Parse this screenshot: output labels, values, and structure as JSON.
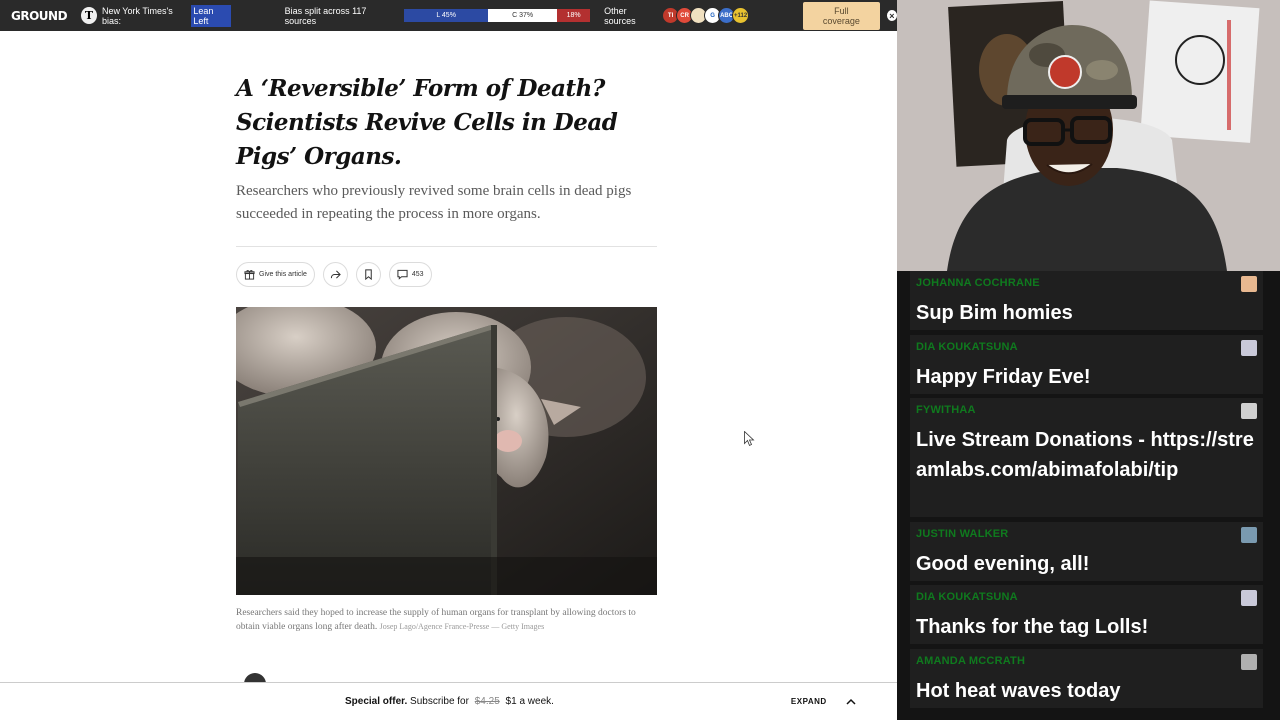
{
  "ground_bar": {
    "logo": "GROUND",
    "publisher_icon": "T",
    "bias_label": "New York Times's bias:",
    "bias_value": "Lean Left",
    "split_label": "Bias split across 117 sources",
    "left_pct": "L 45%",
    "center_pct": "C 37%",
    "right_pct": "18%",
    "other_sources_label": "Other sources",
    "source_icons": [
      "TI",
      "CR",
      "",
      "G",
      "ABC",
      "+112"
    ],
    "full_coverage_label": "Full coverage",
    "close_glyph": "×"
  },
  "article": {
    "headline": "A ‘Reversible’ Form of Death? Scientists Revive Cells in Dead Pigs’ Organs.",
    "dek": "Researchers who previously revived some brain cells in dead pigs succeeded in repeating the process in more organs.",
    "gift_label": "Give this article",
    "comment_count": "453",
    "caption": "Researchers said they hoped to increase the supply of human organs for transplant by allowing doctors to obtain viable organs long after death.",
    "credit": "Josep Lago/Agence France-Presse — Getty Images"
  },
  "offer_bar": {
    "bold": "Special offer.",
    "text": "Subscribe for",
    "old_price": "$4.25",
    "new_price": "$1 a week.",
    "expand_label": "EXPAND"
  },
  "chat": {
    "messages": [
      {
        "user": "JOHANNA COCHRANE",
        "text": "Sup Bim homies",
        "avatar_color": "#e8b890"
      },
      {
        "user": "DIA KOUKATSUNA",
        "text": "Happy Friday Eve!",
        "avatar_color": "#c9c9d9"
      },
      {
        "user": "FYWITHAA",
        "text": "Live Stream Donations - https://streamlabs.com/abimafolabi/tip",
        "avatar_color": "#d0d0d0"
      },
      {
        "user": "JUSTIN WALKER",
        "text": "Good evening, all!",
        "avatar_color": "#7a9ab0"
      },
      {
        "user": "DIA KOUKATSUNA",
        "text": "Thanks for the tag Lolls!",
        "avatar_color": "#c9c9d9"
      },
      {
        "user": "AMANDA MCCRATH",
        "text": "Hot heat waves today",
        "avatar_color": "#b0b0b0"
      }
    ]
  },
  "colors": {
    "chat_username": "#0f7a1e",
    "bias_left": "#2c4aa3",
    "bias_right": "#b33030",
    "full_coverage_bg": "#f3d3a0"
  }
}
